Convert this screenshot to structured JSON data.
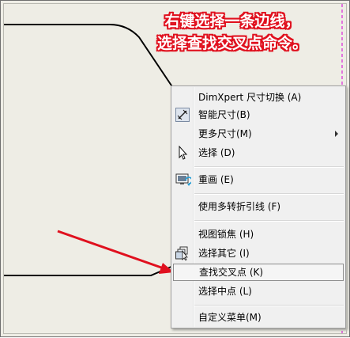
{
  "annotation": {
    "line1": "右键选择一条边线，",
    "line2": "选择查找交叉点命令。"
  },
  "context_menu": {
    "items": [
      {
        "label": "DimXpert 尺寸切换 (A)"
      },
      {
        "label": "智能尺寸(B)",
        "icon": "smart-dimension-icon"
      },
      {
        "label": "更多尺寸(M)",
        "submenu": true
      },
      {
        "label": "选择 (D)",
        "icon": "cursor-arrow-icon"
      },
      {
        "label": "重画 (E)",
        "icon": "redraw-monitor-icon"
      },
      {
        "label": "使用多转折引线 (F)"
      },
      {
        "label": "视图锁焦 (H)"
      },
      {
        "label": "选择其它 (I)",
        "icon": "select-other-icon"
      },
      {
        "label": "查找交叉点 (K)",
        "highlighted": true
      },
      {
        "label": "选择中点 (L)"
      },
      {
        "label": "自定义菜单(M)"
      }
    ]
  },
  "colors": {
    "annotation": "#e0101e",
    "arrow": "#e0101e",
    "canvas_bg": "#eeede5",
    "boundary_dashed": "#d400d4"
  }
}
